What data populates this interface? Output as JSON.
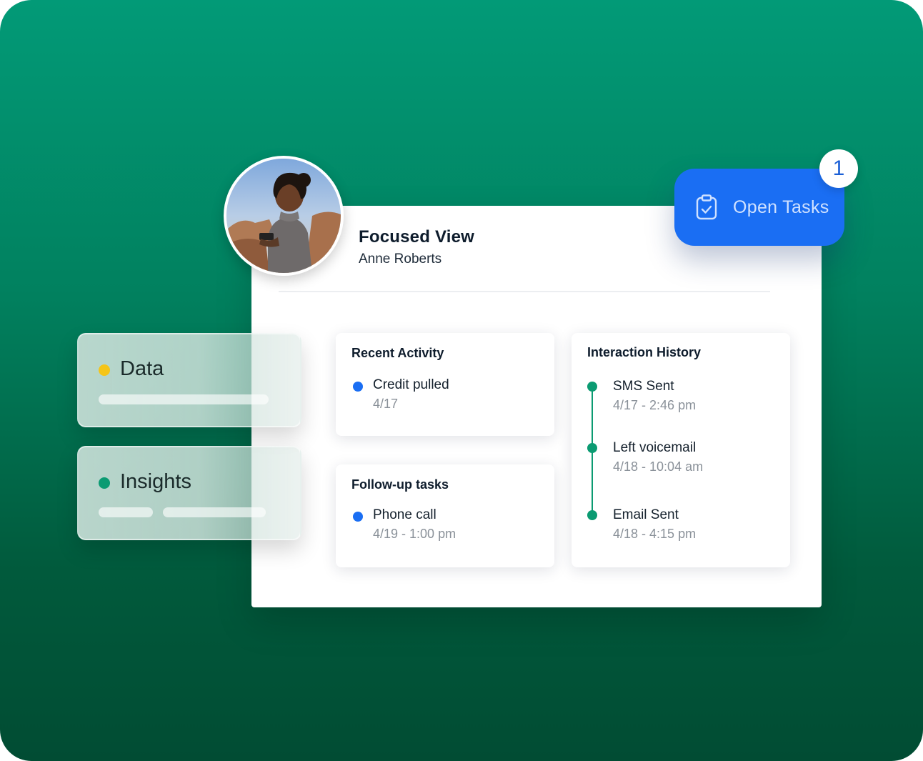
{
  "profile": {
    "view_title": "Focused View",
    "customer_name": "Anne Roberts"
  },
  "open_tasks": {
    "label": "Open Tasks",
    "count": "1",
    "accent": "#1a6ef3"
  },
  "recent_activity": {
    "title": "Recent Activity",
    "items": [
      {
        "label": "Credit pulled",
        "date": "4/17"
      }
    ]
  },
  "follow_up_tasks": {
    "title": "Follow-up tasks",
    "items": [
      {
        "label": "Phone call",
        "date": "4/19 - 1:00 pm"
      }
    ]
  },
  "interaction_history": {
    "title": "Interaction History",
    "items": [
      {
        "label": "SMS Sent",
        "date": "4/17 - 2:46 pm"
      },
      {
        "label": "Left voicemail",
        "date": "4/18 - 10:04 am"
      },
      {
        "label": "Email Sent",
        "date": "4/18 - 4:15 pm"
      }
    ]
  },
  "side_panels": [
    {
      "label": "Data",
      "dot_color": "#f5c518"
    },
    {
      "label": "Insights",
      "dot_color": "#0b9b72"
    }
  ],
  "colors": {
    "bullet_blue": "#1a6ef3",
    "timeline_green": "#0b9b72",
    "background_green": "#01815f"
  }
}
